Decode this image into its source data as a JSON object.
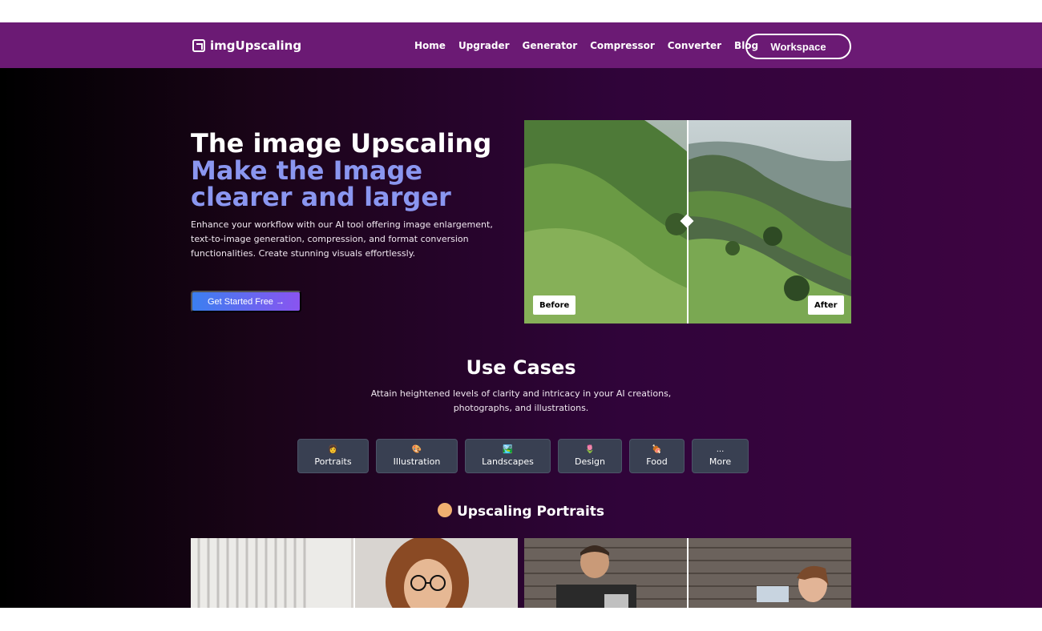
{
  "nav": {
    "logo": "imgUpscaling",
    "links": [
      "Home",
      "Upgrader",
      "Generator",
      "Compressor",
      "Converter",
      "Blog"
    ],
    "workspace": "Workspace"
  },
  "hero": {
    "title": "The image Upscaling",
    "subtitle": "Make the Image clearer and larger",
    "description": "Enhance your workflow with our AI tool offering image enlargement, text-to-image generation, compression, and format conversion functionalities. Create stunning visuals effortlessly.",
    "cta": "Get Started Free →",
    "compare": {
      "before": "Before",
      "after": "After"
    }
  },
  "use_cases": {
    "title": "Use Cases",
    "description": "Attain heightened levels of clarity and intricacy in your AI creations, photographs, and illustrations.",
    "chips": [
      {
        "emoji": "👩",
        "label": "Portraits"
      },
      {
        "emoji": "🎨",
        "label": "Illustration"
      },
      {
        "emoji": "🏞️",
        "label": "Landscapes"
      },
      {
        "emoji": "🌷",
        "label": "Design"
      },
      {
        "emoji": "🍖",
        "label": "Food"
      },
      {
        "emoji": "...",
        "label": "More"
      }
    ]
  },
  "portraits_section": {
    "title": "Upscaling Portraits"
  },
  "colors": {
    "navbar": "#6b1a74",
    "accent": "#8a96f0",
    "chip_bg": "#394052"
  }
}
